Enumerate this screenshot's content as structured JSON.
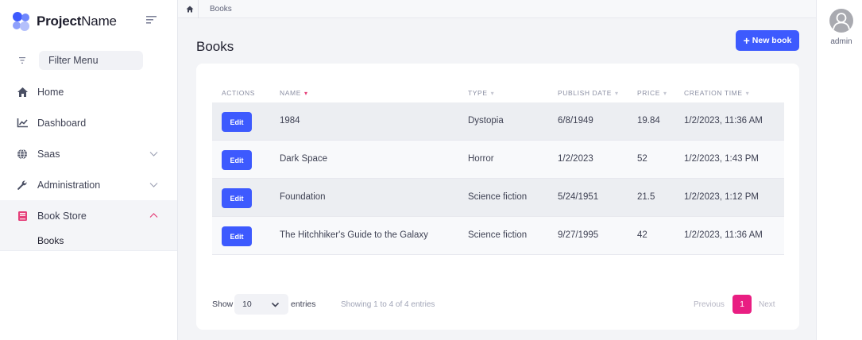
{
  "brand": {
    "name_bold": "Project",
    "name_regular": "Name"
  },
  "sidebar": {
    "filter_placeholder": "Filter Menu",
    "items": [
      {
        "label": "Home",
        "icon": "home-icon"
      },
      {
        "label": "Dashboard",
        "icon": "chart-line-icon"
      },
      {
        "label": "Saas",
        "icon": "globe-icon",
        "expandable": true
      },
      {
        "label": "Administration",
        "icon": "wrench-icon",
        "expandable": true
      },
      {
        "label": "Book Store",
        "icon": "book-icon",
        "expandable": true,
        "expanded": true
      }
    ],
    "subitems": [
      {
        "label": "Books"
      }
    ]
  },
  "breadcrumb": {
    "current": "Books"
  },
  "page": {
    "title": "Books",
    "new_button": "New book"
  },
  "table": {
    "headers": [
      "ACTIONS",
      "NAME",
      "TYPE",
      "PUBLISH DATE",
      "PRICE",
      "CREATION TIME"
    ],
    "edit_label": "Edit",
    "rows": [
      {
        "name": "1984",
        "type": "Dystopia",
        "publish_date": "6/8/1949",
        "price": "19.84",
        "creation_time": "1/2/2023, 11:36 AM"
      },
      {
        "name": "Dark Space",
        "type": "Horror",
        "publish_date": "1/2/2023",
        "price": "52",
        "creation_time": "1/2/2023, 1:43 PM"
      },
      {
        "name": "Foundation",
        "type": "Science fiction",
        "publish_date": "5/24/1951",
        "price": "21.5",
        "creation_time": "1/2/2023, 1:12 PM"
      },
      {
        "name": "The Hitchhiker's Guide to the Galaxy",
        "type": "Science fiction",
        "publish_date": "9/27/1995",
        "price": "42",
        "creation_time": "1/2/2023, 11:36 AM"
      }
    ]
  },
  "footer": {
    "show_label": "Show",
    "entries_value": "10",
    "entries_label": "entries",
    "info": "Showing 1 to 4 of 4 entries",
    "previous": "Previous",
    "current_page": "1",
    "next": "Next"
  },
  "user": {
    "name": "admin"
  },
  "colors": {
    "primary": "#3d5afe",
    "accent": "#e91e82",
    "background": "#f3f4f7"
  }
}
